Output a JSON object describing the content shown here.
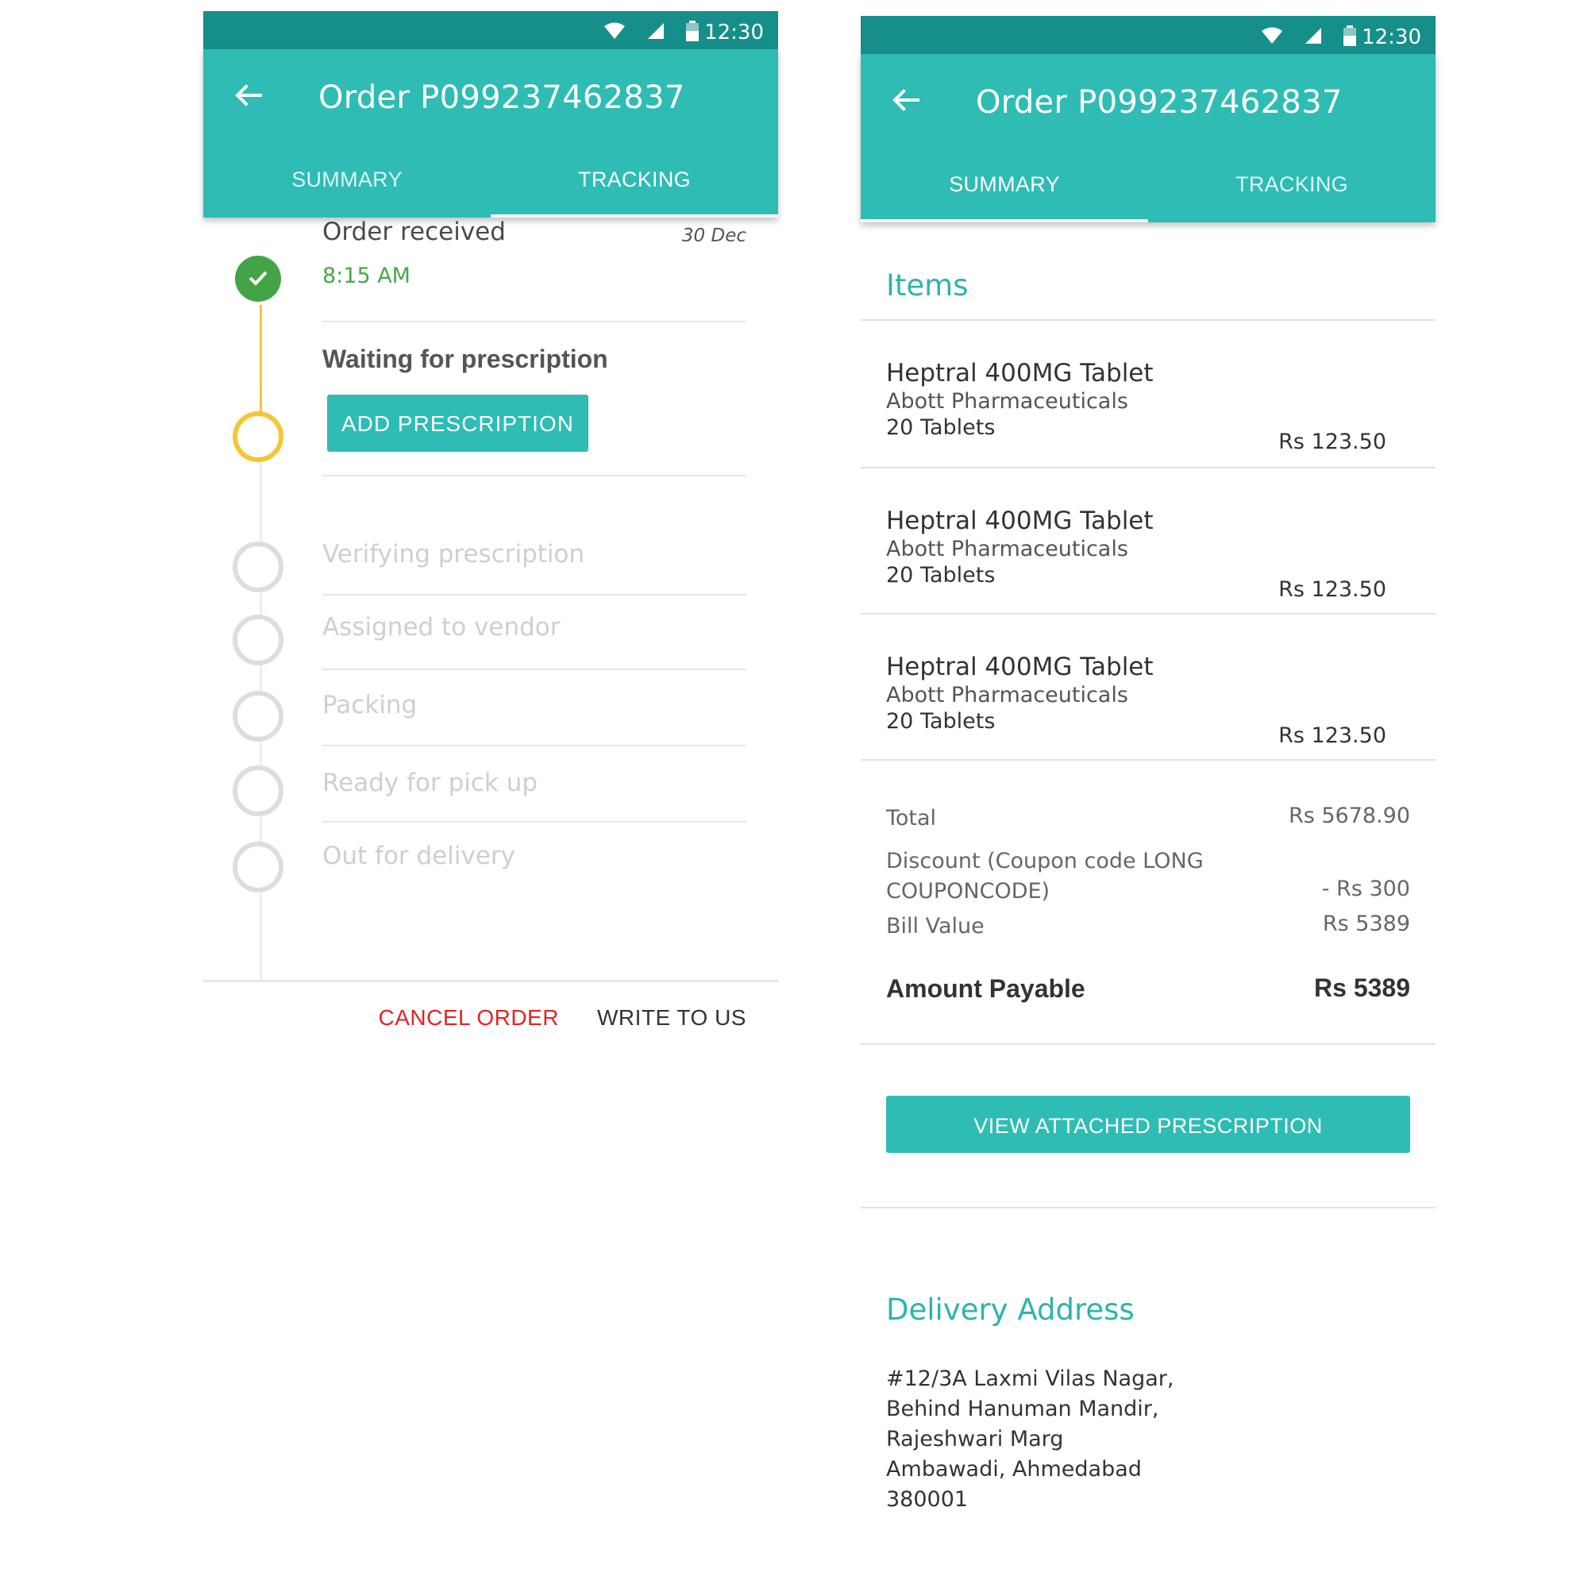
{
  "status_bar": {
    "time": "12:30"
  },
  "app_bar": {
    "title": "Order P099237462837"
  },
  "tabs": {
    "summary": "SUMMARY",
    "tracking": "TRACKING"
  },
  "colors": {
    "primary": "#2ebcb5",
    "status_bar": "#168f8a",
    "done": "#43a447",
    "current": "#f7c534",
    "pending": "#dddddd",
    "cancel": "#e52222"
  },
  "tracking": {
    "steps": [
      {
        "title": "Order received",
        "time": "8:15 AM",
        "date": "30 Dec",
        "state": "done"
      },
      {
        "title": "Waiting for prescription",
        "state": "current",
        "action": "ADD PRESCRIPTION"
      },
      {
        "title": "Verifying prescription",
        "state": "pending"
      },
      {
        "title": "Assigned to vendor",
        "state": "pending"
      },
      {
        "title": "Packing",
        "state": "pending"
      },
      {
        "title": "Ready for pick up",
        "state": "pending"
      },
      {
        "title": "Out for delivery",
        "state": "pending"
      }
    ],
    "actions": {
      "cancel": "CANCEL ORDER",
      "write": "WRITE TO US"
    }
  },
  "summary": {
    "items_title": "Items",
    "items": [
      {
        "name": "Heptral 400MG Tablet",
        "manufacturer": "Abott Pharmaceuticals",
        "quantity": "20 Tablets",
        "price": "Rs 123.50"
      },
      {
        "name": "Heptral 400MG Tablet",
        "manufacturer": "Abott Pharmaceuticals",
        "quantity": "20 Tablets",
        "price": "Rs 123.50"
      },
      {
        "name": "Heptral 400MG Tablet",
        "manufacturer": "Abott Pharmaceuticals",
        "quantity": "20 Tablets",
        "price": "Rs 123.50"
      }
    ],
    "bill": {
      "total_label": "Total",
      "total_value": "Rs 5678.90",
      "discount_label": "Discount (Coupon code LONG COUPONCODE)",
      "discount_value": "- Rs 300",
      "bill_label": "Bill Value",
      "bill_value": "Rs 5389",
      "payable_label": "Amount Payable",
      "payable_value": "Rs 5389"
    },
    "view_prescription": "VIEW ATTACHED PRESCRIPTION",
    "address_title": "Delivery Address",
    "address_lines": [
      "#12/3A Laxmi Vilas Nagar,",
      "Behind Hanuman Mandir,",
      "Rajeshwari Marg",
      "Ambawadi, Ahmedabad",
      "380001"
    ]
  }
}
